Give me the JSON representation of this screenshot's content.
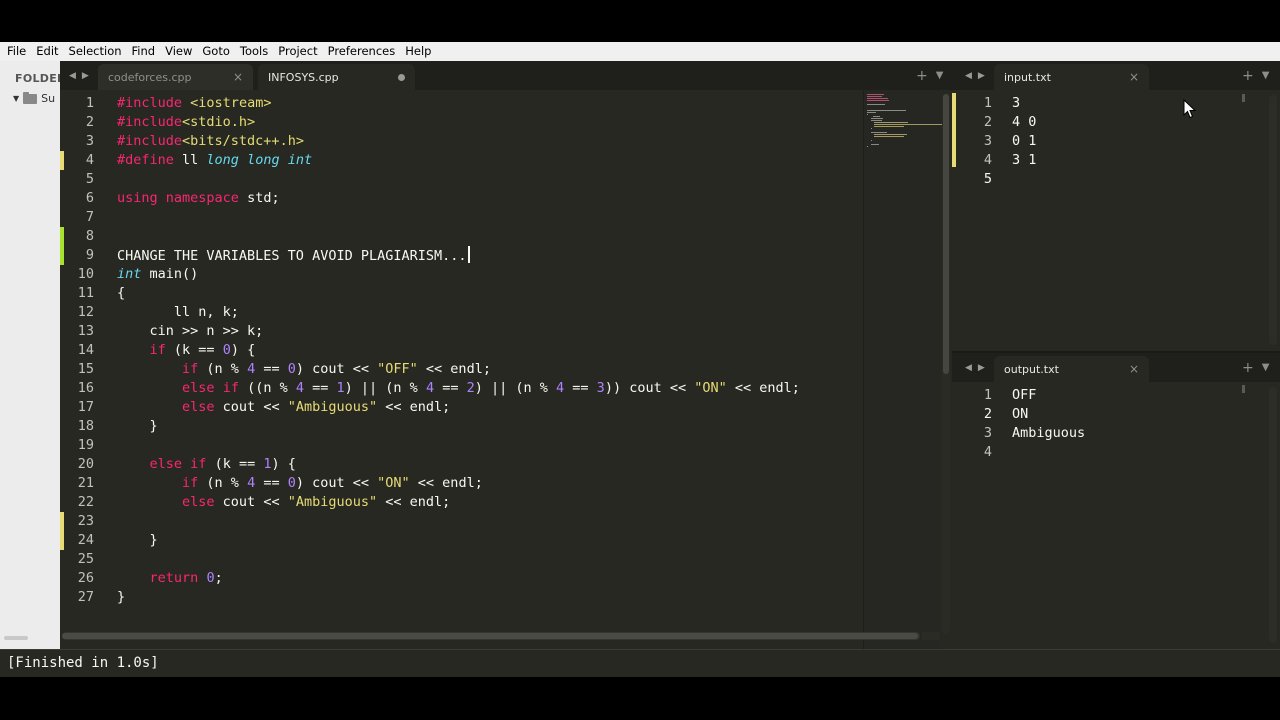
{
  "menubar": [
    "File",
    "Edit",
    "Selection",
    "Find",
    "View",
    "Goto",
    "Tools",
    "Project",
    "Preferences",
    "Help"
  ],
  "sidebar": {
    "title": "FOLDER",
    "folder_label": "Su"
  },
  "left_pane": {
    "tabs": [
      {
        "label": "codeforces.cpp",
        "active": false,
        "dirty": false
      },
      {
        "label": "INFOSYS.cpp",
        "active": true,
        "dirty": true
      }
    ],
    "line_numbers": [
      "1",
      "2",
      "3",
      "4",
      "5",
      "6",
      "7",
      "8",
      "9",
      "10",
      "11",
      "12",
      "13",
      "14",
      "15",
      "16",
      "17",
      "18",
      "19",
      "20",
      "21",
      "22",
      "23",
      "24",
      "25",
      "26",
      "27"
    ],
    "code_lines": [
      "#include <iostream>",
      "#include<stdio.h>",
      "#include<bits/stdc++.h>",
      "#define ll long long int",
      "",
      "using namespace std;",
      "",
      "",
      "CHANGE THE VARIABLES TO AVOID PLAGIARISM...",
      "int main()",
      "{",
      "       ll n, k;",
      "    cin >> n >> k;",
      "    if (k == 0) {",
      "        if (n % 4 == 0) cout << \"OFF\" << endl;",
      "        else if ((n % 4 == 1) || (n % 4 == 2) || (n % 4 == 3)) cout << \"ON\" << endl;",
      "        else cout << \"Ambiguous\" << endl;",
      "    }",
      "",
      "    else if (k == 1) {",
      "        if (n % 4 == 0) cout << \"ON\" << endl;",
      "        else cout << \"Ambiguous\" << endl;",
      "",
      "    }",
      "",
      "    return 0;",
      "}"
    ]
  },
  "input_pane": {
    "tab_label": "input.txt",
    "line_numbers": [
      "1",
      "2",
      "3",
      "4",
      "5"
    ],
    "lines": [
      "3",
      "4 0",
      "0 1",
      "3 1",
      ""
    ]
  },
  "output_pane": {
    "tab_label": "output.txt",
    "line_numbers": [
      "1",
      "2",
      "3",
      "4"
    ],
    "lines": [
      "OFF",
      "ON",
      "Ambiguous",
      ""
    ]
  },
  "console": {
    "text": "[Finished in 1.0s]"
  },
  "icons": {
    "nav_prev": "◀",
    "nav_next": "▶",
    "close": "×",
    "add": "+",
    "dropdown": "▼",
    "folder_expand": "▼"
  },
  "colors": {
    "editor_bg": "#272822",
    "keyword": "#f92672",
    "string": "#e6db74",
    "number": "#ae81ff",
    "type": "#66d9ef",
    "text": "#f8f8f2"
  }
}
